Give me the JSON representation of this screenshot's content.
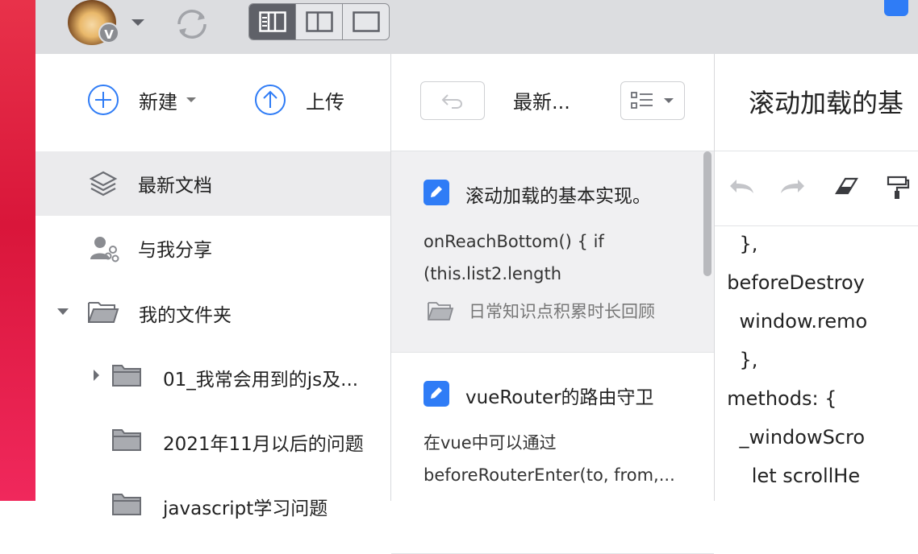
{
  "toolbar": {
    "avatar_badge": "V",
    "icons": [
      "avatar",
      "chevron-down-icon",
      "sync-icon",
      "three-column-view-icon",
      "two-column-view-icon",
      "single-column-view-icon"
    ]
  },
  "left": {
    "actions": {
      "new_label": "新建",
      "upload_label": "上传"
    },
    "nav": [
      {
        "label": "最新文档",
        "icon": "layers-icon"
      },
      {
        "label": "与我分享",
        "icon": "shared-users-icon"
      }
    ],
    "my_folder": {
      "label": "我的文件夹"
    },
    "folders": [
      {
        "label": "01_我常会用到的js及..."
      },
      {
        "label": "2021年11月以后的问题"
      },
      {
        "label": "javascript学习问题"
      }
    ]
  },
  "middle": {
    "title": "最新...",
    "docs": [
      {
        "title": "滚动加载的基本实现。",
        "snippet_line1": "onReachBottom() { if",
        "snippet_line2": "(this.list2.length",
        "folder": "日常知识点积累时长回顾"
      },
      {
        "title": "vueRouter的路由守卫",
        "snippet_line1": "在vue中可以通过",
        "snippet_line2": "beforeRouterEnter(to, from,..."
      }
    ]
  },
  "editor": {
    "title": "滚动加载的基",
    "code_lines": [
      "    },",
      "  beforeDestroy",
      "    window.remo",
      "    },",
      "  methods: {",
      "    _windowScro",
      "      let scrollHe"
    ]
  },
  "colors": {
    "accent": "#2f7cf6",
    "sidebar_active": "#ebebed",
    "toolbar_bg": "#dcdde0"
  }
}
